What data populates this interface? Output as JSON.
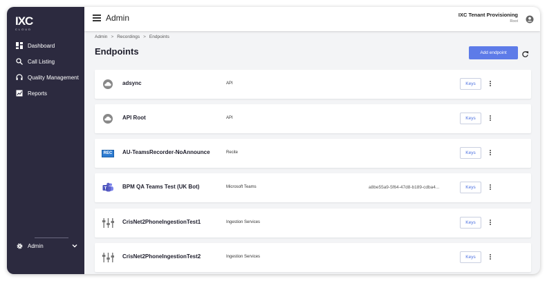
{
  "logo": {
    "main": "IXC",
    "sub": "CLOUD"
  },
  "sidebar": {
    "items": [
      {
        "label": "Dashboard",
        "icon": "dashboard-icon"
      },
      {
        "label": "Call Listing",
        "icon": "search-icon"
      },
      {
        "label": "Quality Management",
        "icon": "headset-icon"
      },
      {
        "label": "Reports",
        "icon": "reports-icon"
      }
    ],
    "footer": {
      "label": "Admin",
      "icon": "gear-icon"
    }
  },
  "header": {
    "title": "Admin",
    "tenant_name": "IXC Tenant Provisioning",
    "tenant_role": "Root"
  },
  "breadcrumb": [
    "Admin",
    "Recordings",
    "Endpoints"
  ],
  "page": {
    "title": "Endpoints",
    "add_button": "Add endpoint"
  },
  "endpoints": [
    {
      "name": "adsync",
      "type": "API",
      "id": "",
      "icon": "cloud-icon",
      "keys_label": "Keys"
    },
    {
      "name": "API Root",
      "type": "API",
      "id": "",
      "icon": "cloud-icon",
      "keys_label": "Keys"
    },
    {
      "name": "AU-TeamsRecorder-NoAnnounce",
      "type": "Recite",
      "id": "",
      "icon": "rec-icon",
      "icon_text": "REC",
      "keys_label": "Keys"
    },
    {
      "name": "BPM QA Teams Test (UK Bot)",
      "type": "Microsoft Teams",
      "id": "a8be55a9-5f64-47d8-b189-cdba4...",
      "icon": "teams-icon",
      "keys_label": "Keys"
    },
    {
      "name": "CrisNet2PhoneIngestionTest1",
      "type": "Ingestion Services",
      "id": "",
      "icon": "ingestion-icon",
      "keys_label": "Keys"
    },
    {
      "name": "CrisNet2PhoneIngestionTest2",
      "type": "Ingestion Services",
      "id": "",
      "icon": "ingestion-icon",
      "keys_label": "Keys"
    }
  ],
  "colors": {
    "sidebar_bg": "#2c2a3f",
    "accent": "#5d7be8",
    "page_bg": "#f3f4f6",
    "teams_purple": "#5b5fc7",
    "rec_blue": "#2d7bd1"
  }
}
